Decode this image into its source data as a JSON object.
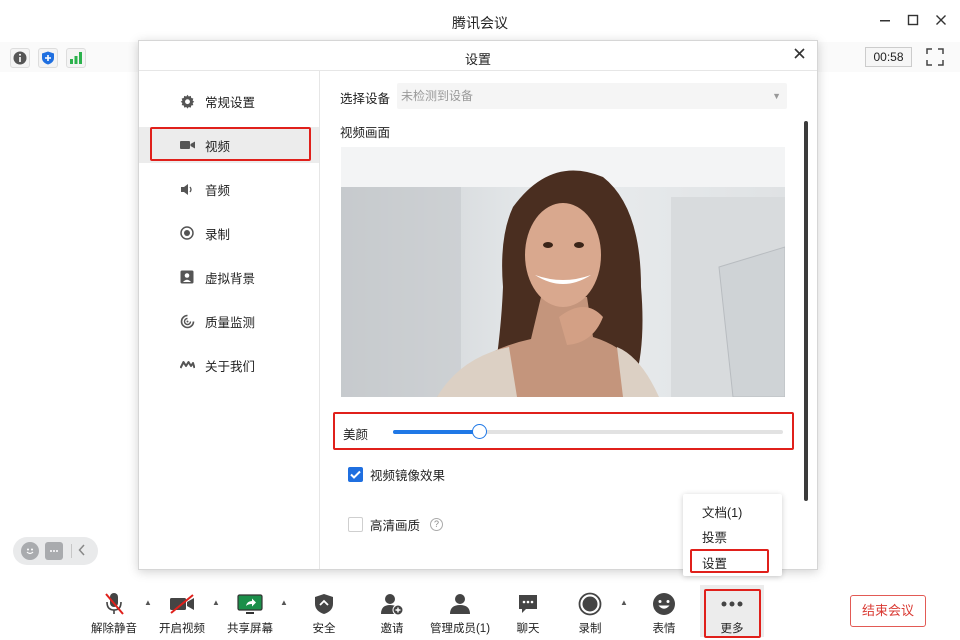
{
  "window": {
    "title": "腾讯会议",
    "timer": "00:58"
  },
  "dialog": {
    "title": "设置",
    "nav": [
      {
        "label": "常规设置",
        "icon": "gear-icon"
      },
      {
        "label": "视频",
        "icon": "camera-icon",
        "active": true
      },
      {
        "label": "音频",
        "icon": "speaker-icon"
      },
      {
        "label": "录制",
        "icon": "record-icon"
      },
      {
        "label": "虚拟背景",
        "icon": "portrait-icon"
      },
      {
        "label": "质量监测",
        "icon": "monitor-icon"
      },
      {
        "label": "关于我们",
        "icon": "logo-icon"
      }
    ],
    "video": {
      "device_label": "选择设备",
      "device_value": "未检测到设备",
      "preview_label": "视频画面",
      "beauty_label": "美颜",
      "beauty_level": 0.22,
      "mirror_label": "视频镜像效果",
      "mirror_checked": true,
      "hd_label": "高清画质",
      "hd_checked": false
    }
  },
  "popup_menu": {
    "items": [
      "文档(1)",
      "投票",
      "设置"
    ]
  },
  "toolbar": {
    "items": [
      "解除静音",
      "开启视频",
      "共享屏幕",
      "安全",
      "邀请",
      "管理成员(1)",
      "聊天",
      "录制",
      "表情",
      "更多"
    ],
    "end_label": "结束会议"
  },
  "colors": {
    "accent": "#1f78e6",
    "highlight": "#e0201b",
    "end": "#d93a33"
  }
}
